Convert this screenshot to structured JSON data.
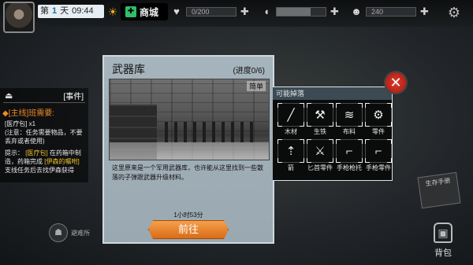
{
  "header": {
    "day": {
      "prefix": "第",
      "number": "1",
      "suffix": "天",
      "time": "09:44"
    },
    "shop_label": "商城",
    "stats": [
      {
        "name": "health",
        "icon": "heart-icon",
        "glyph": "♥",
        "value_text": "0/200",
        "fill": 0.0
      },
      {
        "name": "hunger",
        "icon": "stomach-icon",
        "glyph": "◖",
        "value_text": "",
        "fill": 0.7
      },
      {
        "name": "sanity",
        "icon": "brain-icon",
        "glyph": "☻",
        "value_text": "240",
        "fill": 0.0
      }
    ]
  },
  "quest": {
    "events_label": "[事件]",
    "main_title": "[主线]班需要:",
    "item_line": "[医疗包] x1",
    "note": "(注意：任务需要物品，不要丢弃或者使用)",
    "hint_prefix": "提示：",
    "hint_item": "[医疗包]",
    "hint_mid": "在药箱中制造，药箱完成",
    "hint_item2": "[伊森的嘱咐]",
    "hint_tail": "支线任务后去找伊森获得"
  },
  "scav_label": "避难所",
  "dialog": {
    "title": "武器库",
    "progress": "(进度0/6)",
    "difficulty": "简单",
    "description": "这里原来是一个军用武器库，也许能从这里找到一些散落的子弹跟武器升级材料。",
    "time": "1小时53分",
    "go_label": "前往"
  },
  "drops": {
    "header": "可能掉落",
    "items": [
      {
        "name": "木材",
        "icon": "wood-icon",
        "glyph": "╱"
      },
      {
        "name": "生铁",
        "icon": "iron-icon",
        "glyph": "⚒"
      },
      {
        "name": "布料",
        "icon": "cloth-icon",
        "glyph": "≋"
      },
      {
        "name": "零件",
        "icon": "gear-part-icon",
        "glyph": "⚙"
      },
      {
        "name": "箭",
        "icon": "arrow-icon",
        "glyph": "⇡"
      },
      {
        "name": "匕首零件",
        "icon": "dagger-part-icon",
        "glyph": "⚔"
      },
      {
        "name": "手枪枪托",
        "icon": "pistol-stock-icon",
        "glyph": "⌐"
      },
      {
        "name": "手枪零件",
        "icon": "pistol-part-icon",
        "glyph": "⌐"
      }
    ]
  },
  "book_label": "生存手册",
  "bag_label": "背包"
}
